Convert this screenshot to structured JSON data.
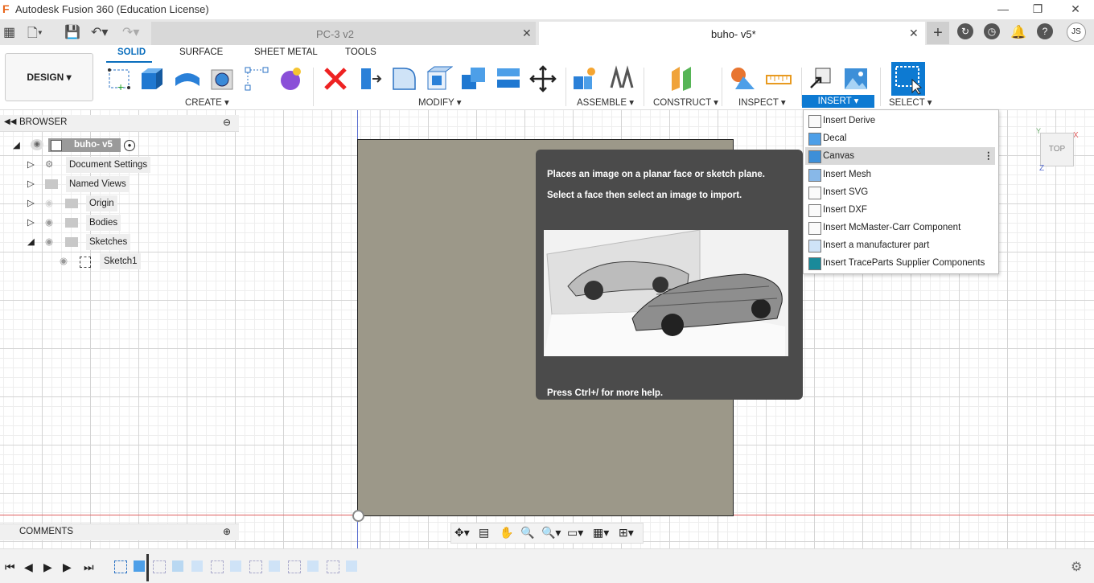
{
  "window": {
    "title": "Autodesk Fusion 360 (Education License)",
    "logo": "F",
    "minimize_icon": "minimize-icon",
    "maximize_icon": "maximize-icon",
    "close_icon": "close-icon"
  },
  "tabs": [
    {
      "label": "PC-3 v2",
      "active": false
    },
    {
      "label": "buho- v5*",
      "active": true
    }
  ],
  "user_initials": "JS",
  "design_menu": "DESIGN ▾",
  "toolbar_tabs": [
    "SOLID",
    "SURFACE",
    "SHEET METAL",
    "TOOLS"
  ],
  "toolbar_groups": {
    "create": "CREATE ▾",
    "modify": "MODIFY ▾",
    "assemble": "ASSEMBLE ▾",
    "construct": "CONSTRUCT ▾",
    "inspect": "INSPECT ▾",
    "insert": "INSERT ▾",
    "select": "SELECT ▾"
  },
  "browser": {
    "title": "BROWSER",
    "root": "buho- v5",
    "items": [
      {
        "label": "Document Settings",
        "icon": "gear-icon"
      },
      {
        "label": "Named Views",
        "icon": "folder-icon"
      },
      {
        "label": "Origin",
        "icon": "folder-icon"
      },
      {
        "label": "Bodies",
        "icon": "folder-icon"
      },
      {
        "label": "Sketches",
        "icon": "folder-icon"
      },
      {
        "label": "Sketch1",
        "icon": "sketch-icon"
      }
    ]
  },
  "tooltip": {
    "line1": "Places an image on a planar face or sketch plane.",
    "line2": "Select a face then select an image to import.",
    "footer": "Press Ctrl+/ for more help."
  },
  "insert_menu": {
    "items": [
      {
        "label": "Insert Derive",
        "highlighted": false
      },
      {
        "label": "Decal",
        "highlighted": false
      },
      {
        "label": "Canvas",
        "highlighted": true
      },
      {
        "label": "Insert Mesh",
        "highlighted": false
      },
      {
        "label": "Insert SVG",
        "highlighted": false
      },
      {
        "label": "Insert DXF",
        "highlighted": false
      },
      {
        "label": "Insert McMaster-Carr Component",
        "highlighted": false
      },
      {
        "label": "Insert a manufacturer part",
        "highlighted": false
      },
      {
        "label": "Insert TraceParts Supplier Components",
        "highlighted": false
      }
    ]
  },
  "viewcube_label": "TOP",
  "comments_label": "COMMENTS",
  "colors": {
    "accent": "#0d7ad2",
    "plate": "#9c9889",
    "tooltip_bg": "#4b4b4b"
  }
}
